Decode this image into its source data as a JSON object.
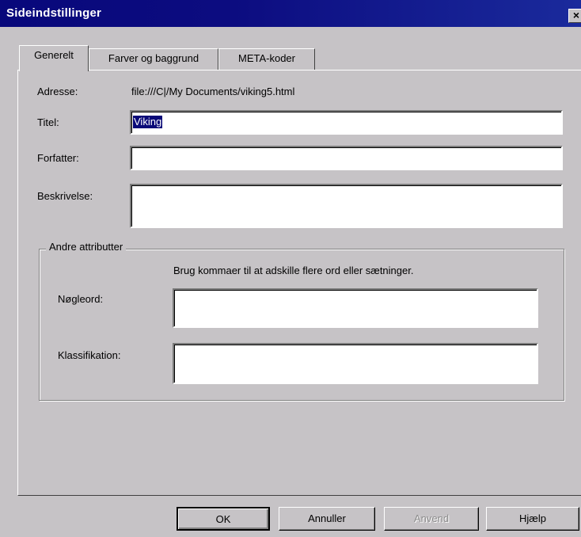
{
  "window": {
    "title": "Sideindstillinger",
    "close_label": "×"
  },
  "tabs": [
    {
      "label": "Generelt",
      "active": true
    },
    {
      "label": "Farver og baggrund",
      "active": false
    },
    {
      "label": "META-koder",
      "active": false
    }
  ],
  "general": {
    "address_label": "Adresse:",
    "address_value": "file:///C|/My Documents/viking5.html",
    "title_label": "Titel:",
    "title_value": "Viking",
    "author_label": "Forfatter:",
    "author_value": "",
    "description_label": "Beskrivelse:",
    "description_value": ""
  },
  "other_attributes": {
    "legend": "Andre attributter",
    "hint": "Brug kommaer til at adskille flere ord eller sætninger.",
    "keywords_label": "Nøgleord:",
    "keywords_value": "",
    "classification_label": "Klassifikation:",
    "classification_value": ""
  },
  "buttons": {
    "ok": "OK",
    "cancel": "Annuller",
    "apply": "Anvend",
    "help": "Hjælp"
  },
  "colors": {
    "titlebar": "#08087b",
    "dialog_bg": "#c6c3c6",
    "selection": "#0a0a78"
  }
}
